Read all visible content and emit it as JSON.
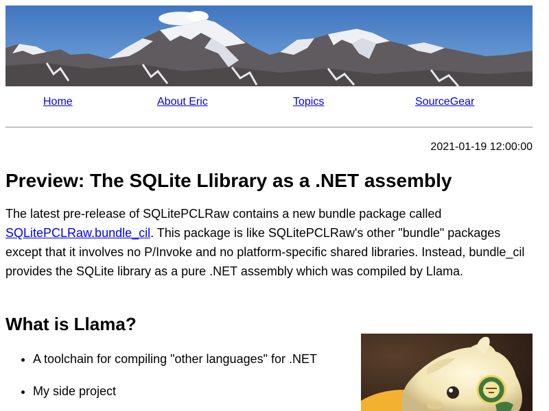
{
  "banner": {
    "image": "mountain-range-photo"
  },
  "nav": {
    "home": "Home",
    "about": "About Eric",
    "topics": "Topics",
    "sourcegear": "SourceGear"
  },
  "post": {
    "date": "2021-01-19 12:00:00",
    "title": "Preview: The SQLite Llibrary as a .NET assembly",
    "intro_before_link": "The latest pre-release of SQLitePCLRaw contains a new bundle package called ",
    "intro_link": "SQLitePCLRaw.bundle_cil",
    "intro_after_link": ". This package is like SQLitePCLRaw's other \"bundle\" packages except that it involves no P/Invoke and no platform-specific shared libraries. Instead, bundle_cil provides the SQLite library as a pure .NET assembly which was compiled by Llama.",
    "section_heading": "What is Llama?",
    "bullets": [
      "A toolchain for compiling \"other languages\" for .NET",
      "My side project"
    ],
    "photo": "plush-llama-photo"
  },
  "colors": {
    "link": "#0000ee",
    "sky": "#4f82c6",
    "rule": "#9a9a9a"
  }
}
